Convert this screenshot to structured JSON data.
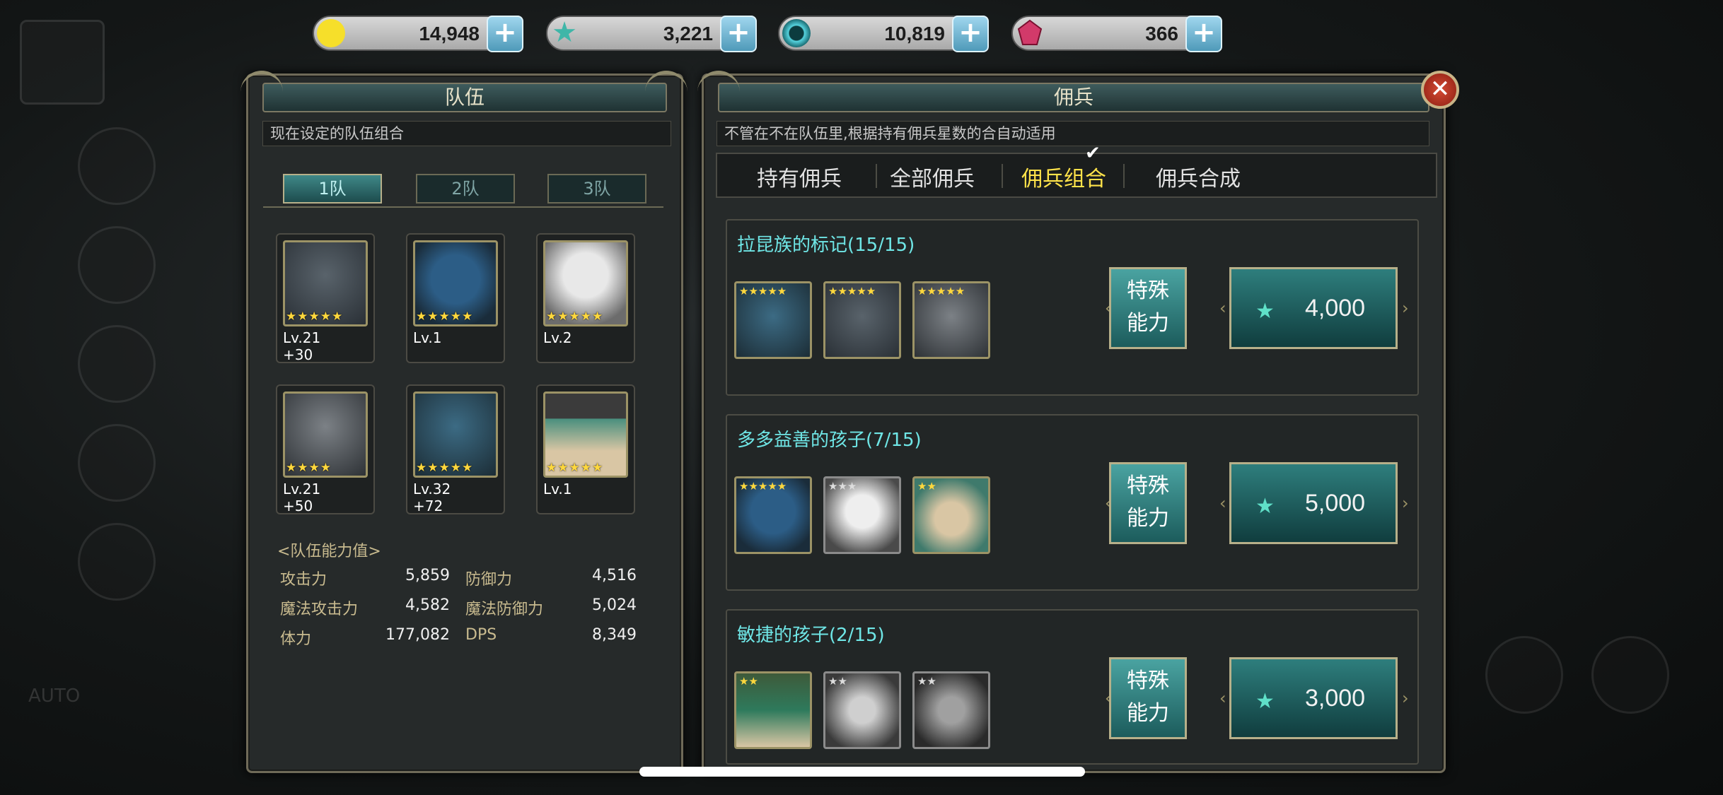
{
  "currencies": [
    {
      "icon": "gold-coin-icon",
      "value": "14,948",
      "color": "#f6df2a"
    },
    {
      "icon": "star-gem-icon",
      "value": "3,221",
      "color": "#3fb6a8"
    },
    {
      "icon": "crystal-orb-icon",
      "value": "10,819",
      "color": "#56d4df"
    },
    {
      "icon": "ruby-icon",
      "value": "366",
      "color": "#d23a6a"
    }
  ],
  "team_panel": {
    "title": "队伍",
    "subtitle": "现在设定的队伍组合",
    "tabs": [
      "1队",
      "2队",
      "3队"
    ],
    "active_tab": "1队",
    "slots": [
      {
        "level": "Lv.21",
        "plus": "+30",
        "stars": "★★★★★",
        "icon": "hooded-soldier-portrait"
      },
      {
        "level": "Lv.1",
        "plus": "",
        "stars": "★★★★★",
        "icon": "yellow-dot-helmet-portrait"
      },
      {
        "level": "Lv.2",
        "plus": "",
        "stars": "★★★★★",
        "icon": "white-beast-portrait"
      },
      {
        "level": "Lv.21",
        "plus": "+50",
        "stars": "★★★★",
        "icon": "gray-knight-portrait"
      },
      {
        "level": "Lv.32",
        "plus": "+72",
        "stars": "★★★★★",
        "icon": "blue-hood-portrait"
      },
      {
        "level": "Lv.1",
        "plus": "",
        "stars": "★★★★★",
        "icon": "pirate-girl-portrait"
      }
    ],
    "stats_title": "<队伍能力值>",
    "stats": [
      {
        "label": "攻击力",
        "value": "5,859"
      },
      {
        "label": "防御力",
        "value": "4,516"
      },
      {
        "label": "魔法攻击力",
        "value": "4,582"
      },
      {
        "label": "魔法防御力",
        "value": "5,024"
      },
      {
        "label": "体力",
        "value": "177,082"
      },
      {
        "label": "DPS",
        "value": "8,349"
      }
    ]
  },
  "merc_panel": {
    "title": "佣兵",
    "subtitle": "不管在不在队伍里,根据持有佣兵星数的合自动适用",
    "tabs": [
      "持有佣兵",
      "全部佣兵",
      "佣兵组合",
      "佣兵合成"
    ],
    "active_tab": "佣兵组合",
    "combos": [
      {
        "title": "拉昆族的标记(15/15)",
        "special": "特殊\n能力",
        "special_l1": "特殊",
        "special_l2": "能力",
        "cost": "4,000",
        "icons": [
          {
            "stars": "★★★★★",
            "gray": false
          },
          {
            "stars": "★★★★★",
            "gray": false
          },
          {
            "stars": "★★★★★",
            "gray": false
          }
        ]
      },
      {
        "title": "多多益善的孩子(7/15)",
        "special_l1": "特殊",
        "special_l2": "能力",
        "cost": "5,000",
        "icons": [
          {
            "stars": "★★★★★",
            "gray": false
          },
          {
            "stars": "★★★",
            "gray": true
          },
          {
            "stars": "★★",
            "gray": false
          }
        ]
      },
      {
        "title": "敏捷的孩子(2/15)",
        "special_l1": "特殊",
        "special_l2": "能力",
        "cost": "3,000",
        "icons": [
          {
            "stars": "★★",
            "gray": false
          },
          {
            "stars": "★★",
            "gray": true
          },
          {
            "stars": "★★",
            "gray": true
          }
        ]
      }
    ]
  },
  "background": {
    "hud_label": "AUTO"
  },
  "colors": {
    "accent_teal": "#2e7e7d",
    "active_tab": "#ffe34a",
    "combo_title": "#6fe6e6",
    "frame_gold": "#b7b08a"
  }
}
